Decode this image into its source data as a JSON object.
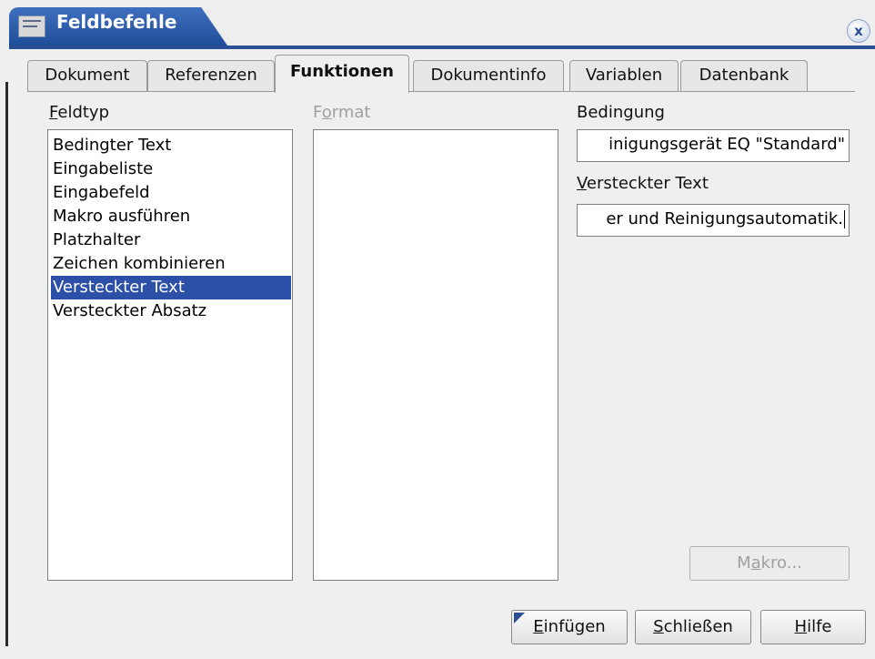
{
  "window": {
    "title": "Feldbefehle",
    "close_glyph": "x",
    "title_icon": "document-icon"
  },
  "tabs": [
    {
      "label": "Dokument",
      "active": false
    },
    {
      "label": "Referenzen",
      "active": false
    },
    {
      "label": "Funktionen",
      "active": true
    },
    {
      "label": "Dokumentinfo",
      "active": false
    },
    {
      "label": "Variablen",
      "active": false
    },
    {
      "label": "Datenbank",
      "active": false
    }
  ],
  "feldtyp": {
    "label_first": "F",
    "label_rest": "eldtyp",
    "items": [
      "Bedingter Text",
      "Eingabeliste",
      "Eingabefeld",
      "Makro ausführen",
      "Platzhalter",
      "Zeichen kombinieren",
      "Versteckter Text",
      "Versteckter Absatz"
    ],
    "selected": "Versteckter Text"
  },
  "format": {
    "label_first": "F",
    "label_u": "o",
    "label_rest": "rmat",
    "disabled": true
  },
  "bedingung": {
    "label_pre": "Bedin",
    "label_u": "g",
    "label_post": "ung",
    "value": "inigungsgerät EQ \"Standard\""
  },
  "versteckter_text": {
    "label_u": "V",
    "label_rest": "ersteckter Text",
    "value": "er und Reinigungsautomatik."
  },
  "buttons": {
    "makro_pre": "M",
    "makro_u": "a",
    "makro_post": "kro...",
    "einfuegen_u": "E",
    "einfuegen_rest": "infügen",
    "schliessen_u": "S",
    "schliessen_rest": "chließen",
    "hilfe_u": "H",
    "hilfe_rest": "ilfe"
  },
  "colors": {
    "title_bar": "#2b4f94",
    "selection": "#2c50a8",
    "dialog_bg": "#efefef"
  }
}
